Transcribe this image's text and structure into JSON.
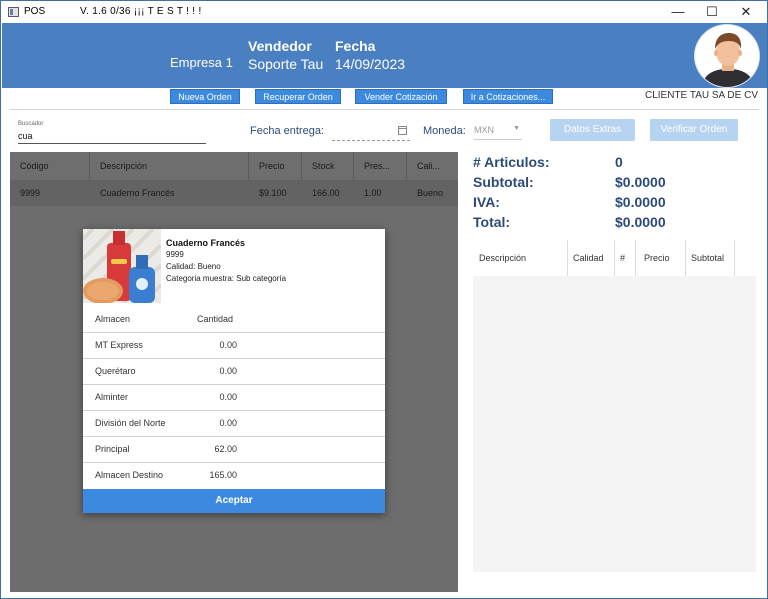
{
  "titlebar": {
    "app_name": "POS",
    "version": "V. 1.6  0/36 ¡¡¡ T E S T ! ! !",
    "minimize": "—",
    "maximize": "☐",
    "close": "✕"
  },
  "header": {
    "company": "Empresa 1",
    "seller_label": "Vendedor",
    "seller_value": "Soporte Tau",
    "date_label": "Fecha",
    "date_value": "14/09/2023"
  },
  "toolbar": {
    "new_order": "Nueva Orden",
    "recover_order": "Recuperar Orden",
    "sell_quote": "Vender Cotización",
    "go_quotes": "Ir a Cotizaciones...",
    "client": "CLIENTE TAU SA DE CV"
  },
  "search": {
    "label": "Buscador",
    "value": "cua"
  },
  "delivery": {
    "label": "Fecha entrega:"
  },
  "currency": {
    "label": "Moneda:",
    "value": "MXN"
  },
  "buttons": {
    "extra_data": "Datos Extras",
    "verify_order": "Verificar Orden"
  },
  "product_table": {
    "columns": [
      "Código",
      "Descripción",
      "Precio",
      "Stock",
      "Pres...",
      "Cali..."
    ],
    "rows": [
      [
        "9999",
        "Cuaderno Francés",
        "$9.100",
        "166.00",
        "1.00",
        "Bueno"
      ]
    ]
  },
  "summary": {
    "items_label": "# Articulos:",
    "items_value": "0",
    "subtotal_label": "Subtotal:",
    "subtotal_value": "$0.0000",
    "iva_label": "IVA:",
    "iva_value": "$0.0000",
    "total_label": "Total:",
    "total_value": "$0.0000"
  },
  "order_table": {
    "columns": [
      "Descripción",
      "Calidad",
      "#",
      "Precio",
      "Subtotal"
    ]
  },
  "modal": {
    "product_name": "Cuaderno Francés",
    "code": "9999",
    "quality": "Calidad: Bueno",
    "category": "Categoria muestra: Sub categoría",
    "col_warehouse": "Almacen",
    "col_quantity": "Cantidad",
    "rows": [
      {
        "warehouse": "MT Express",
        "quantity": "0.00"
      },
      {
        "warehouse": "Querétaro",
        "quantity": "0.00"
      },
      {
        "warehouse": "Alminter",
        "quantity": "0.00"
      },
      {
        "warehouse": "División del Norte",
        "quantity": "0.00"
      },
      {
        "warehouse": "Principal",
        "quantity": "62.00"
      },
      {
        "warehouse": "Almacen Destino",
        "quantity": "165.00"
      }
    ],
    "accept": "Aceptar"
  },
  "colors": {
    "header": "#4a7fc1",
    "button": "#3c8ae0",
    "disabled_button": "#b6d3f1",
    "text_accent": "#2d4b7a"
  },
  "icons": [
    "app-icon",
    "calendar-icon",
    "dropdown-caret-icon",
    "user-avatar",
    "product-image"
  ]
}
